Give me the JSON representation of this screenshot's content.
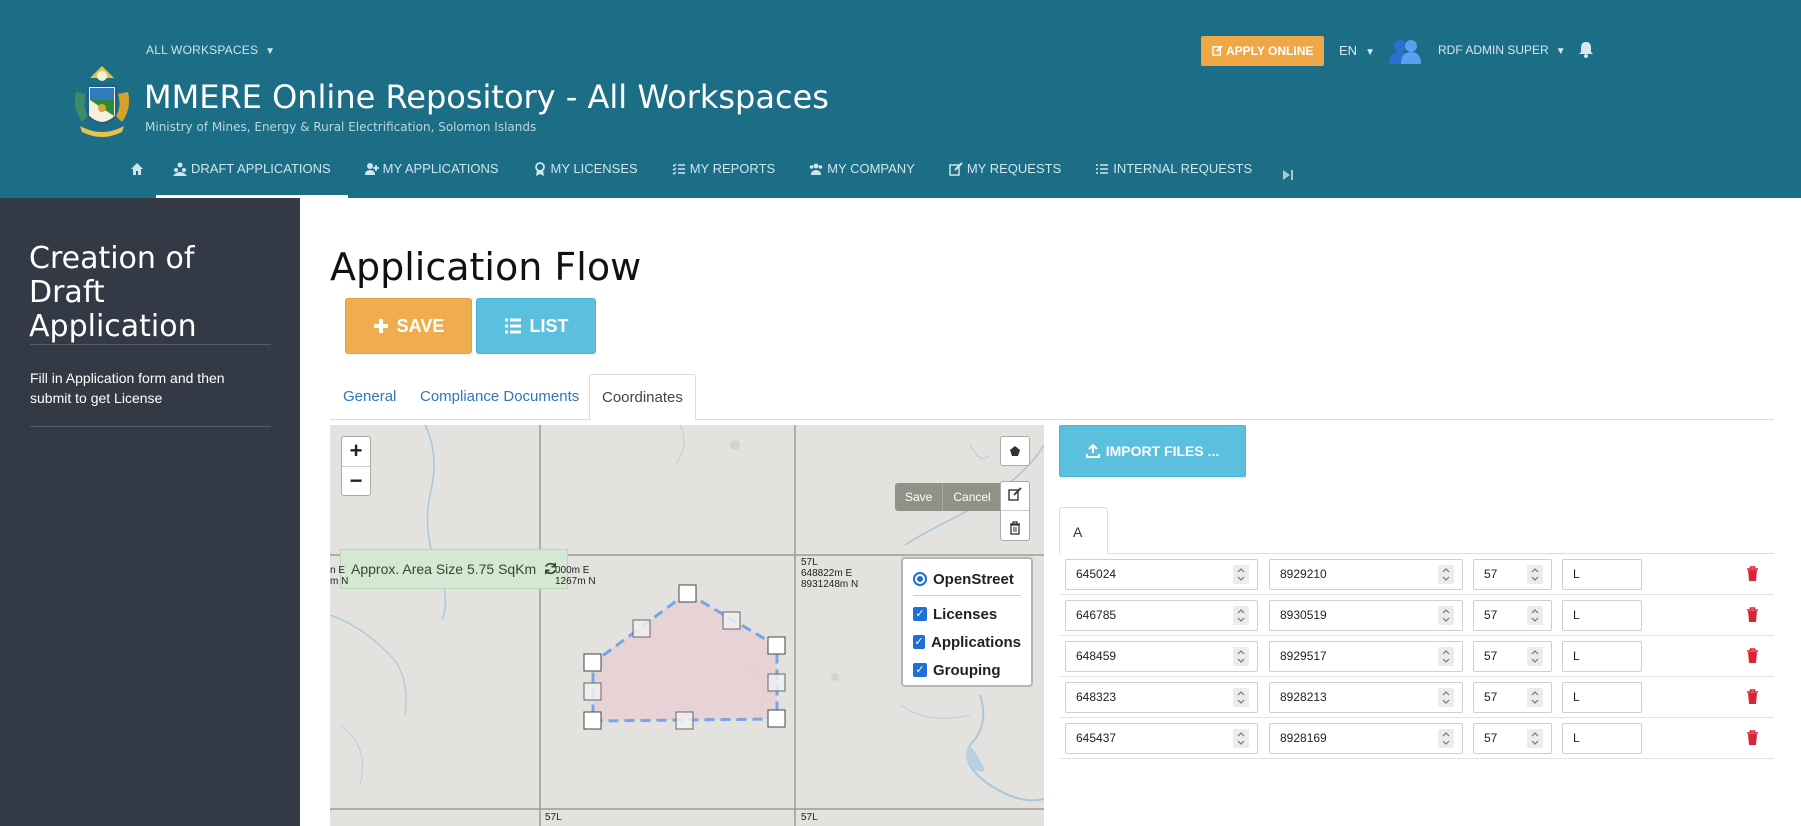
{
  "header": {
    "workspace_label": "ALL WORKSPACES",
    "title": "MMERE Online Repository - All Workspaces",
    "subtitle": "Ministry of Mines, Energy & Rural Electrification, Solomon Islands",
    "apply_button": "APPLY ONLINE",
    "language": "EN",
    "user_name": "RDF ADMIN SUPER",
    "accent_color": "#f0a847",
    "background_color": "#1c6d86"
  },
  "nav": {
    "items": [
      {
        "label": "DRAFT APPLICATIONS",
        "icon": "people-group-icon",
        "active": true
      },
      {
        "label": "MY APPLICATIONS",
        "icon": "user-plus-icon",
        "active": false
      },
      {
        "label": "MY LICENSES",
        "icon": "award-icon",
        "active": false
      },
      {
        "label": "MY REPORTS",
        "icon": "list-check-icon",
        "active": false
      },
      {
        "label": "MY COMPANY",
        "icon": "users-icon",
        "active": false
      },
      {
        "label": "MY REQUESTS",
        "icon": "edit-icon",
        "active": false
      },
      {
        "label": "INTERNAL REQUESTS",
        "icon": "list-icon",
        "active": false
      }
    ]
  },
  "sidebar": {
    "title": "Creation of Draft Application",
    "description": "Fill in Application form and then submit to get License"
  },
  "main": {
    "page_title": "Application Flow",
    "save_label": "SAVE",
    "list_label": "LIST",
    "tabs": [
      {
        "label": "General",
        "active": false
      },
      {
        "label": "Compliance Documents",
        "active": false
      },
      {
        "label": "Coordinates",
        "active": true
      }
    ]
  },
  "map": {
    "area_label": "Approx. Area Size 5.75 SqKm",
    "save_label": "Save",
    "cancel_label": "Cancel",
    "grid_labels": [
      {
        "line1": "n E",
        "line2": "m N"
      },
      {
        "line1": "000m E",
        "line2": "1267m N"
      },
      {
        "line1": "57L",
        "line2": "648822m E",
        "line3": "8931248m N"
      },
      {
        "line1": "57L"
      },
      {
        "line1": "57L"
      }
    ],
    "layers": {
      "base": "OpenStreet",
      "overlays": [
        "Licenses",
        "Applications",
        "Grouping"
      ]
    }
  },
  "coordinates": {
    "import_label": "IMPORT FILES ...",
    "group_tab": "A",
    "rows": [
      {
        "easting": "645024",
        "northing": "8929210",
        "zone": "57",
        "band": "L"
      },
      {
        "easting": "646785",
        "northing": "8930519",
        "zone": "57",
        "band": "L"
      },
      {
        "easting": "648459",
        "northing": "8929517",
        "zone": "57",
        "band": "L"
      },
      {
        "easting": "648323",
        "northing": "8928213",
        "zone": "57",
        "band": "L"
      },
      {
        "easting": "645437",
        "northing": "8928169",
        "zone": "57",
        "band": "L"
      }
    ]
  }
}
